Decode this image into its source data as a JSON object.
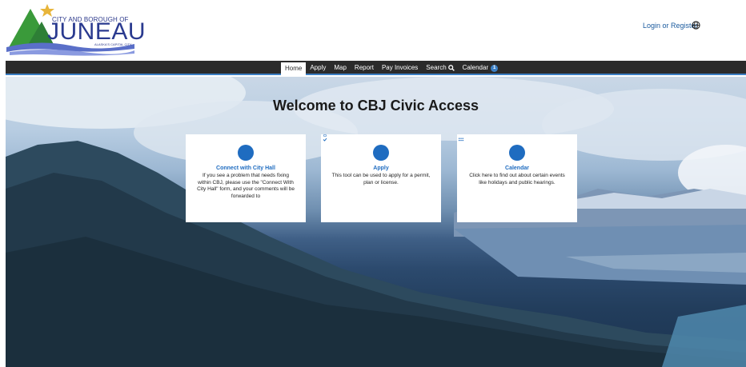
{
  "header": {
    "logo": {
      "top_text": "CITY AND BOROUGH OF",
      "main_text": "JUNEAU",
      "sub_text": "ALASKA'S CAPITAL CITY"
    },
    "login_label": "Login or Register",
    "language_icon": "globe-icon"
  },
  "nav": {
    "items": [
      {
        "label": "Home",
        "active": true
      },
      {
        "label": "Apply"
      },
      {
        "label": "Map"
      },
      {
        "label": "Report"
      },
      {
        "label": "Pay Invoices"
      },
      {
        "label": "Search",
        "icon": "search-icon"
      },
      {
        "label": "Calendar",
        "badge": "1"
      }
    ]
  },
  "hero": {
    "title": "Welcome to CBJ Civic Access"
  },
  "cards": [
    {
      "icon": "search-icon",
      "title": "Connect with City Hall",
      "text": "If you see a problem that needs fixing within CBJ, please use the \"Connect With City Hall\" form, and your comments will be forwarded to"
    },
    {
      "icon": "clipboard-icon",
      "title": "Apply",
      "text": "This tool can be used to apply for a permit, plan or license."
    },
    {
      "icon": "calendar-icon",
      "title": "Calendar",
      "text": "Click here to find out about certain events like holidays and public hearings."
    }
  ],
  "colors": {
    "accent": "#1f6cc0",
    "nav_bg": "#2b2b2b",
    "nav_border": "#3b7fc4",
    "logo_navy": "#2a3a8f",
    "logo_green": "#3a9a3a",
    "logo_star": "#e8b53a"
  }
}
